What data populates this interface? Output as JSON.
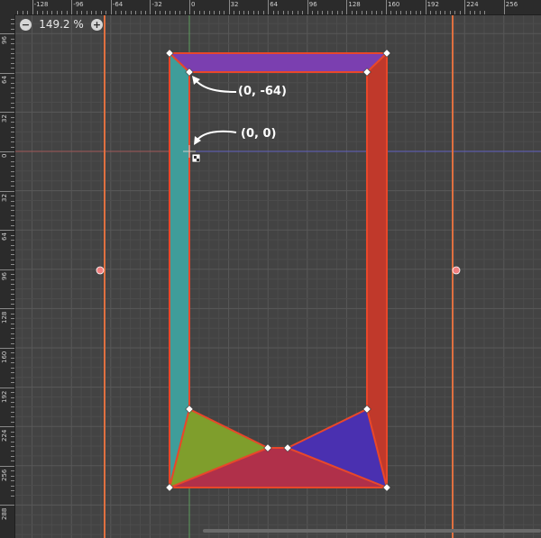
{
  "zoom": {
    "zoom_out_label": "−",
    "level": "149.2 %",
    "zoom_in_label": "+"
  },
  "ruler": {
    "top_labels": [
      "-128",
      "-96",
      "-64",
      "-32",
      "0",
      "32",
      "64",
      "96",
      "128",
      "160",
      "192",
      "224",
      "256"
    ],
    "left_labels": [
      "96",
      "64",
      "32",
      "0",
      "32",
      "64",
      "96",
      "128",
      "160",
      "192",
      "224",
      "256",
      "288"
    ]
  },
  "annotations": {
    "top_vertex": "(0, -64)",
    "origin": "(0, 0)"
  },
  "colors": {
    "background": "#434343",
    "grid_minor": "#4c4c4c",
    "grid_major": "#585858",
    "guide": "#e07040",
    "outline": "#e8472a",
    "teal": "#3f9d9a",
    "purple": "#7b3fb0",
    "red": "#c0392b",
    "green": "#7f9e2c",
    "blue": "#4a30b0",
    "crimson": "#b0304a"
  }
}
